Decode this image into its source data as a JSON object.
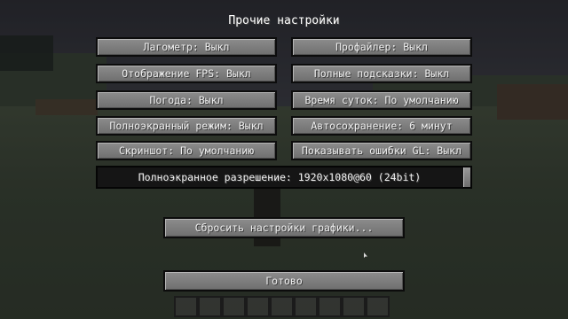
{
  "screen": {
    "title": "Прочие настройки"
  },
  "options": {
    "left": [
      {
        "label": "Лагометр: Выкл"
      },
      {
        "label": "Отображение FPS: Выкл"
      },
      {
        "label": "Погода: Выкл"
      },
      {
        "label": "Полноэкранный режим: Выкл"
      },
      {
        "label": "Скриншот: По умолчанию"
      }
    ],
    "right": [
      {
        "label": "Профайлер: Выкл"
      },
      {
        "label": "Полные подсказки: Выкл"
      },
      {
        "label": "Время суток: По умолчанию"
      },
      {
        "label": "Автосохранение: 6 минут"
      },
      {
        "label": "Показывать ошибки GL: Выкл"
      }
    ]
  },
  "resolution_slider": {
    "label": "Полноэкранное разрешение: 1920x1080@60 (24bit)",
    "level": 1.0
  },
  "buttons": {
    "reset_graphics": "Сбросить настройки графики...",
    "done": "Готово"
  },
  "hotbar": {
    "slot_count": 9
  }
}
